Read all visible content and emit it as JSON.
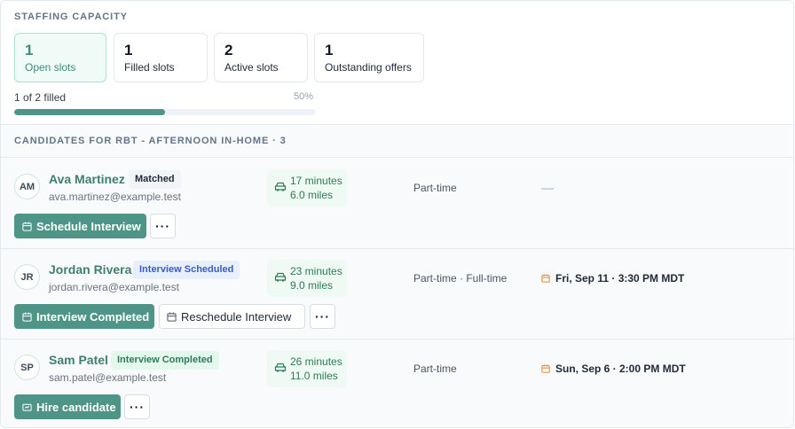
{
  "capacity": {
    "title": "STAFFING CAPACITY",
    "stats": [
      {
        "value": "1",
        "label": "Open slots"
      },
      {
        "value": "1",
        "label": "Filled slots"
      },
      {
        "value": "2",
        "label": "Active slots"
      },
      {
        "value": "1",
        "label": "Outstanding offers"
      }
    ],
    "filled_text": "1 of 2 filled",
    "filled_percent_label": "50%",
    "filled_fraction": 0.5
  },
  "candidates": {
    "header": "CANDIDATES FOR RBT - AFTERNOON IN-HOME",
    "count_label": " · 3",
    "rows": [
      {
        "initials": "AM",
        "name": "Ava Martinez",
        "status": "Matched",
        "email": "ava.martinez@example.test",
        "travel_time": "17 minutes",
        "travel_distance": "6.0 miles",
        "employment": "Part-time",
        "schedule": "",
        "actions": {
          "primary": "Schedule Interview",
          "more": "···"
        }
      },
      {
        "initials": "JR",
        "name": "Jordan Rivera",
        "status": "Interview Scheduled",
        "email": "jordan.rivera@example.test",
        "travel_time": "23 minutes",
        "travel_distance": "9.0 miles",
        "employment": "Part-time · Full-time",
        "schedule": "Fri, Sep 11 · 3:30 PM MDT",
        "actions": {
          "primary": "Interview Completed",
          "secondary": "Reschedule Interview",
          "more": "···"
        }
      },
      {
        "initials": "SP",
        "name": "Sam Patel",
        "status": "Interview Completed",
        "email": "sam.patel@example.test",
        "travel_time": "26 minutes",
        "travel_distance": "11.0 miles",
        "employment": "Part-time",
        "schedule": "Sun, Sep 6 · 2:00 PM MDT",
        "actions": {
          "primary": "Hire candidate",
          "more": "···"
        }
      }
    ]
  },
  "colors": {
    "accent": "#4f9587",
    "name_text": "#3f7f6f",
    "badge_blue": "#e8efff",
    "badge_green": "#e4f8ee",
    "travel_bg": "#eefaf3",
    "calendar_icon": "#e08a3c"
  },
  "icons": {
    "calendar": "calendar-icon",
    "car": "car-icon",
    "hire": "hire-icon",
    "more": "more-icon"
  }
}
